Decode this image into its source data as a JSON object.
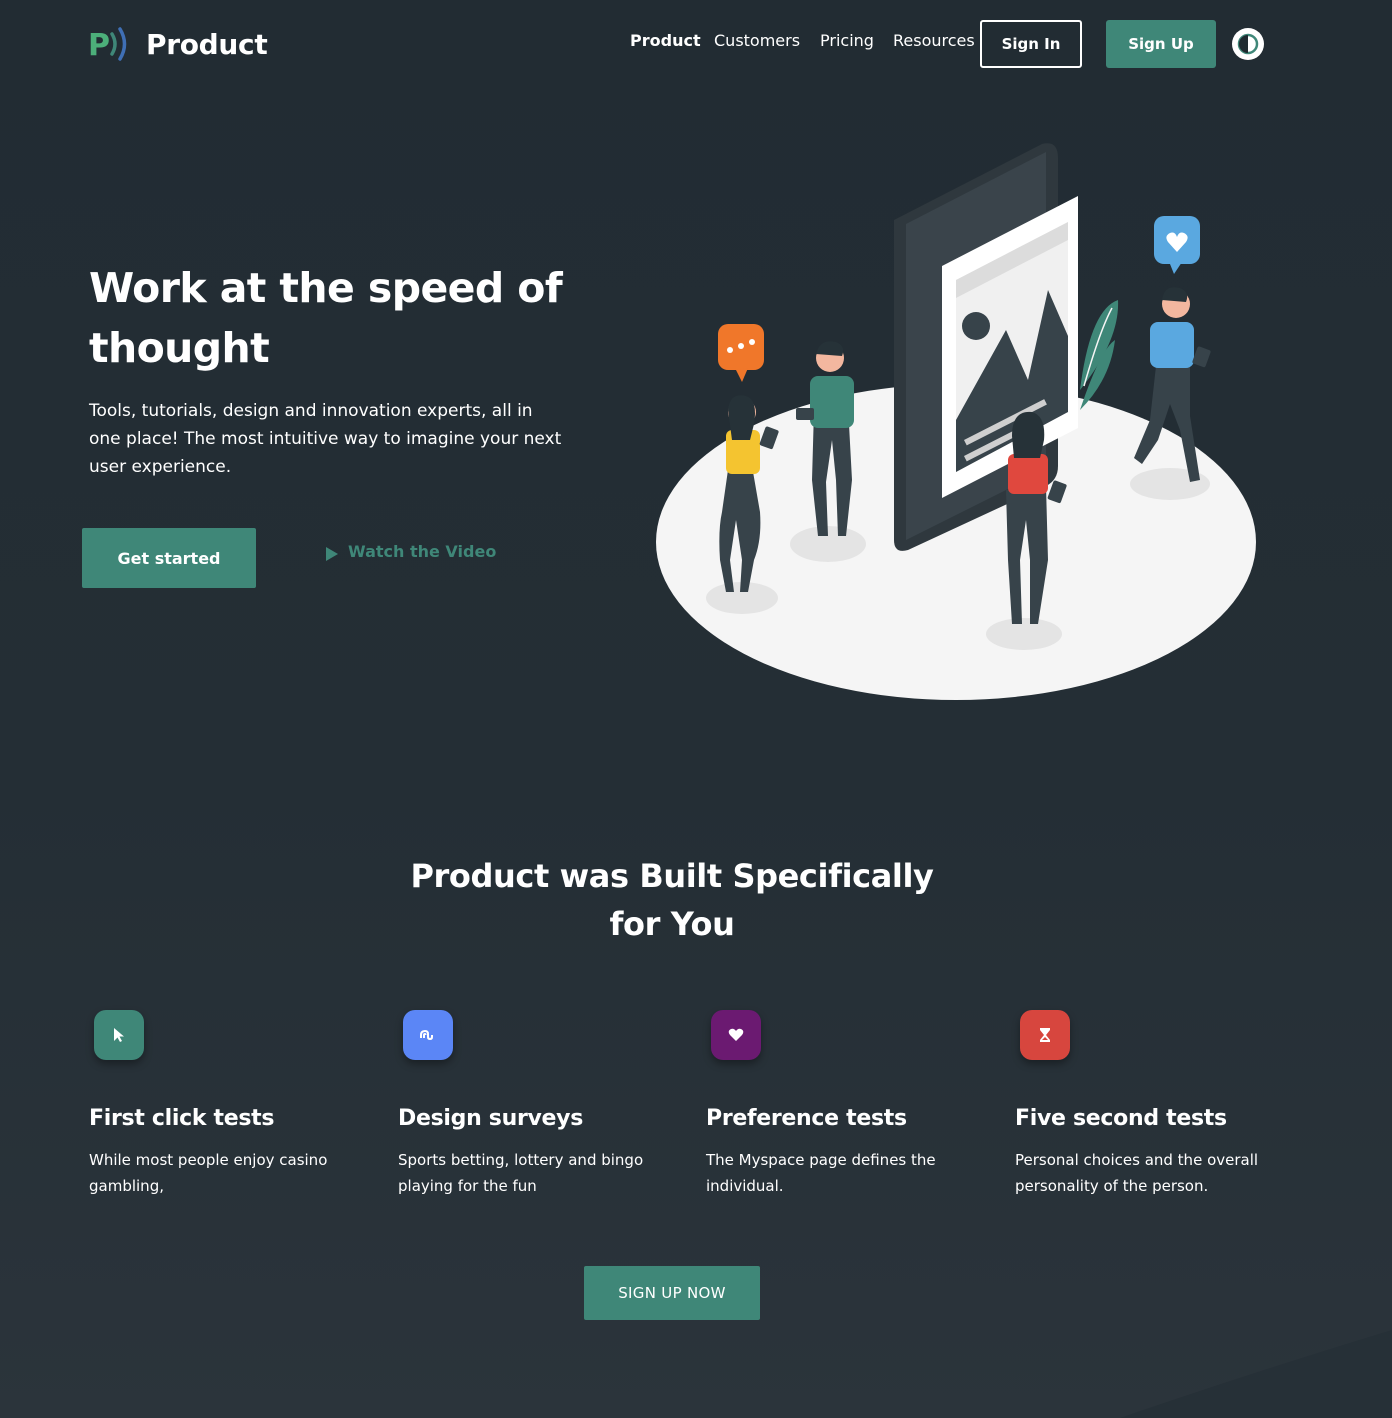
{
  "brand": {
    "name": "Product",
    "logo_letter": "P"
  },
  "nav": {
    "items": [
      {
        "label": "Product",
        "active": true
      },
      {
        "label": "Customers",
        "active": false
      },
      {
        "label": "Pricing",
        "active": false
      },
      {
        "label": "Resources",
        "active": false
      }
    ],
    "sign_in": "Sign In",
    "sign_up": "Sign Up",
    "theme_toggle_icon": "contrast-icon"
  },
  "hero": {
    "title": "Work at the speed of thought",
    "description": "Tools, tutorials, design and innovation experts, all in one place! The most intuitive way to imagine your next user experience.",
    "cta": "Get started",
    "video_link": "Watch the Video"
  },
  "features": {
    "title": "Product was Built Specifically for You",
    "items": [
      {
        "title": "First click tests",
        "text": "While most people enjoy casino gambling,",
        "icon": "cursor-icon",
        "color": "#3f8778"
      },
      {
        "title": "Design surveys",
        "text": "Sports betting, lottery and bingo playing for the fun",
        "icon": "stumbleupon-icon",
        "color": "#5b86f6"
      },
      {
        "title": "Preference tests",
        "text": "The Myspace page defines the individual.",
        "icon": "heart-icon",
        "color": "#6b1a71"
      },
      {
        "title": "Five second tests",
        "text": "Personal choices and the overall personality of the person.",
        "icon": "hourglass-icon",
        "color": "#d7463e"
      }
    ],
    "cta": "SIGN UP NOW"
  },
  "colors": {
    "accent": "#3f8778",
    "background": "#242e35"
  }
}
